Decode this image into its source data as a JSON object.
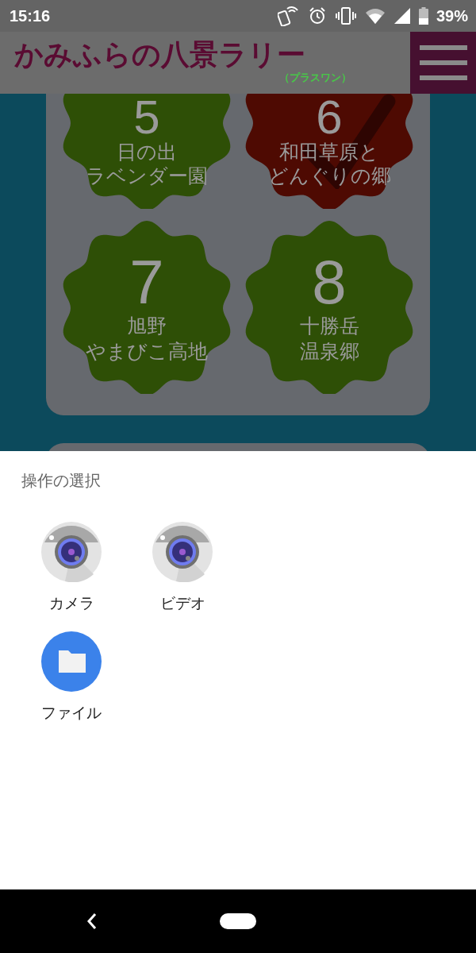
{
  "status_bar": {
    "time": "15:16",
    "battery": "39%"
  },
  "header": {
    "logo": "かみふらの八景ラリー",
    "logo_sub": "（プラスワン）"
  },
  "spots": [
    {
      "number": "5",
      "lines": [
        "日の出",
        "ラベンダー園"
      ],
      "checked": false,
      "color": "#2e4f06"
    },
    {
      "number": "6",
      "lines": [
        "和田草原と",
        "どんぐりの郷"
      ],
      "checked": true,
      "color": "#4e0a02"
    },
    {
      "number": "7",
      "lines": [
        "旭野",
        "やまびこ高地"
      ],
      "checked": false,
      "color": "#2e4f06"
    },
    {
      "number": "8",
      "lines": [
        "十勝岳",
        "温泉郷"
      ],
      "checked": false,
      "color": "#2e4f06"
    }
  ],
  "chooser": {
    "title": "操作の選択",
    "apps": [
      {
        "label": "カメラ",
        "kind": "camera"
      },
      {
        "label": "ビデオ",
        "kind": "camera"
      },
      {
        "label": "ファイル",
        "kind": "files"
      }
    ]
  }
}
